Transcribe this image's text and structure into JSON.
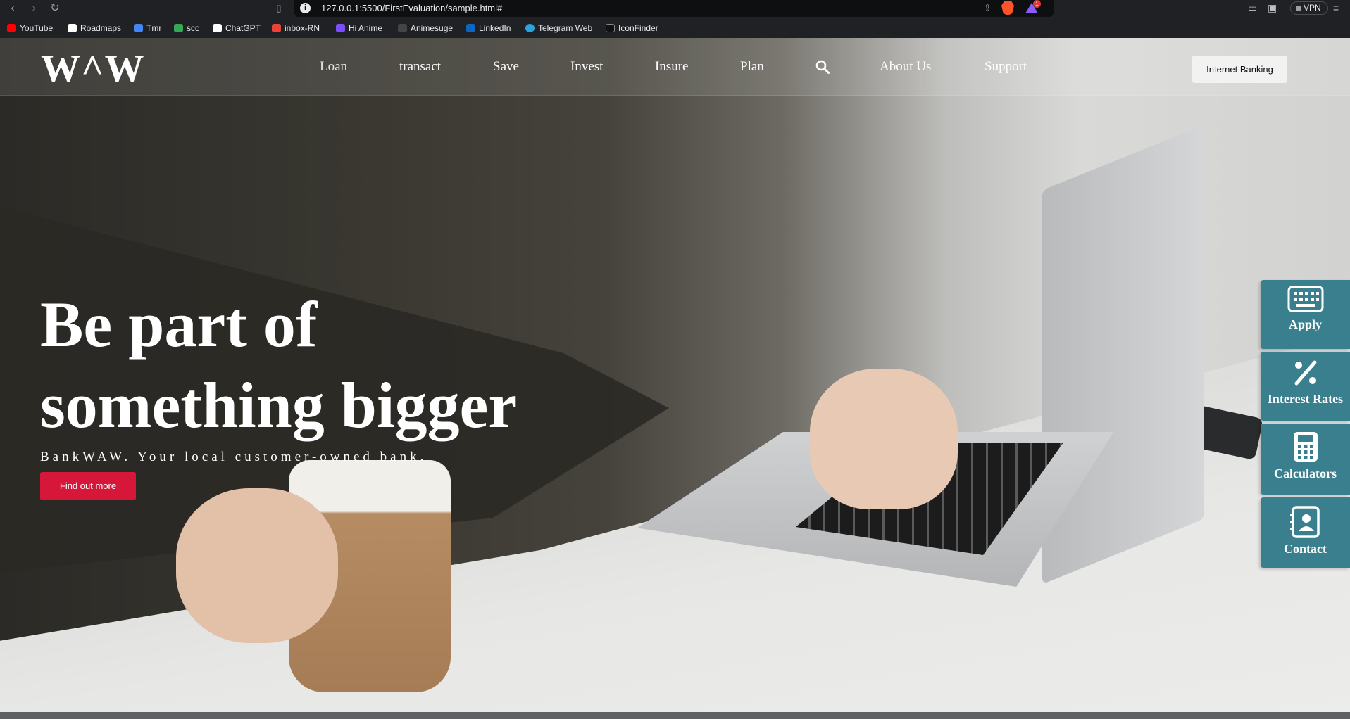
{
  "browser": {
    "url": "127.0.0.1:5500/FirstEvaluation/sample.html#",
    "vpn_label": "VPN",
    "notification_count": "1",
    "bookmarks": [
      {
        "label": "YouTube",
        "color": "#ff0000"
      },
      {
        "label": "Roadmaps",
        "color": "#ffffff"
      },
      {
        "label": "Tmr",
        "color": "#4285f4"
      },
      {
        "label": "scc",
        "color": "#34a853"
      },
      {
        "label": "ChatGPT",
        "color": "#ffffff"
      },
      {
        "label": "inbox-RN",
        "color": "#ea4335"
      },
      {
        "label": "Hi Anime",
        "color": "#7c4dff"
      },
      {
        "label": "Animesuge",
        "color": "#333333"
      },
      {
        "label": "LinkedIn",
        "color": "#0a66c2"
      },
      {
        "label": "Telegram Web",
        "color": "#2aa3df"
      },
      {
        "label": "IconFinder",
        "color": "#111111"
      }
    ]
  },
  "header": {
    "logo": "W^W",
    "menu": [
      "Loan",
      "transact",
      "Save",
      "Invest",
      "Insure",
      "Plan",
      "About Us",
      "Support"
    ],
    "search_icon": "search-icon",
    "internet_banking_label": "Internet Banking"
  },
  "hero": {
    "title_line1": "Be part of",
    "title_line2": "something bigger",
    "subtitle": "BankWAW. Your local customer-owned bank.",
    "cta_label": "Find out more"
  },
  "side_panel": [
    {
      "label": "Apply",
      "icon": "keyboard-icon"
    },
    {
      "label": "Interest Rates",
      "icon": "percent-icon"
    },
    {
      "label": "Calculators",
      "icon": "calculator-icon"
    },
    {
      "label": "Contact",
      "icon": "contact-card-icon"
    }
  ],
  "colors": {
    "accent_red": "#d6173a",
    "side_teal": "#3a7f8e"
  }
}
